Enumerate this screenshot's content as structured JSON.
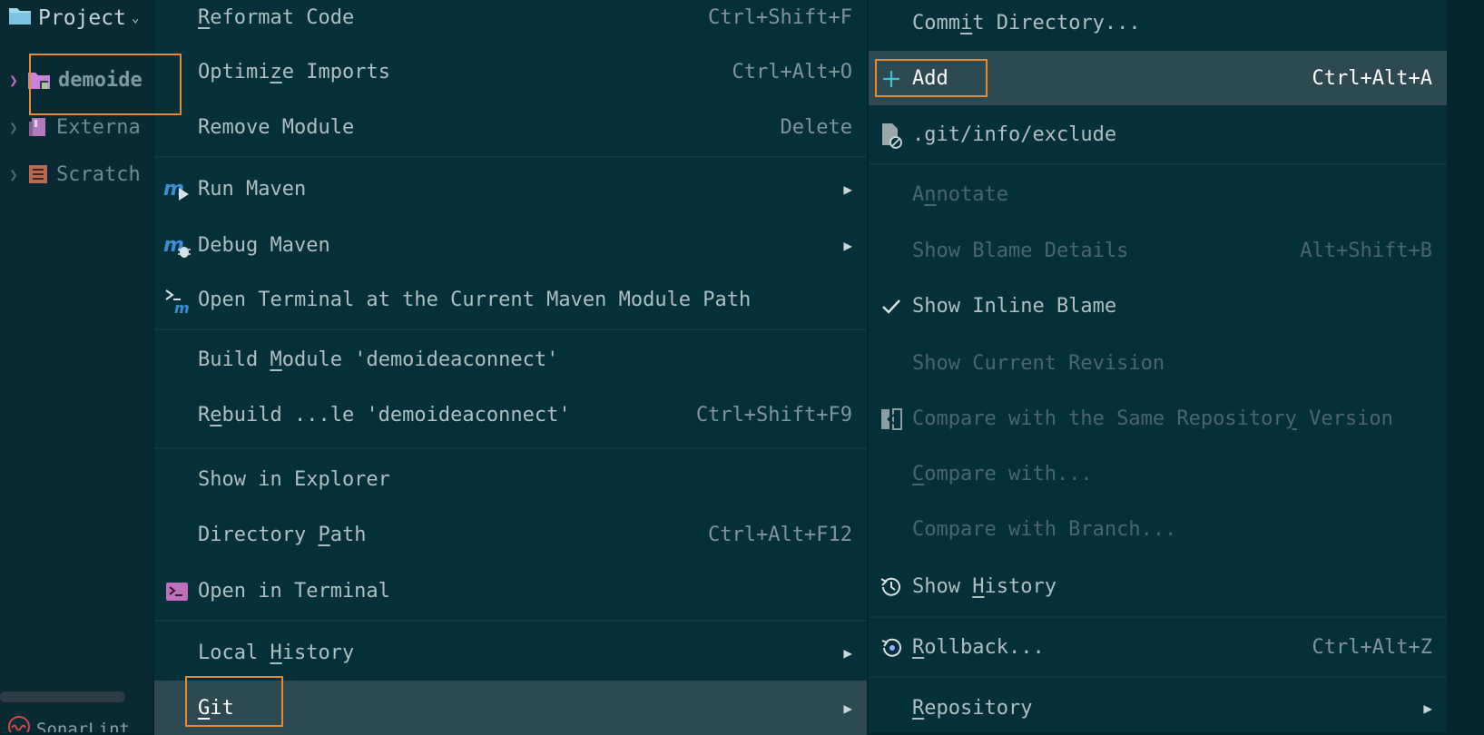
{
  "sidebar": {
    "title": "Project",
    "items": [
      {
        "label": "demoide"
      },
      {
        "label": "Externa"
      },
      {
        "label": "Scratch"
      }
    ],
    "footer": "SonarLint"
  },
  "menu1": {
    "items": [
      {
        "label_pre": "",
        "label_u": "R",
        "label_post": "eformat Code",
        "shortcut": "Ctrl+Shift+F"
      },
      {
        "label_pre": "Optimi",
        "label_u": "z",
        "label_post": "e Imports",
        "shortcut": "Ctrl+Alt+O"
      },
      {
        "label_pre": "Remove Module",
        "label_u": "",
        "label_post": "",
        "shortcut": "Delete"
      },
      {
        "label_pre": "Run Maven",
        "label_u": "",
        "label_post": "",
        "icon": "maven-run-icon"
      },
      {
        "label_pre": "Debug Maven",
        "label_u": "",
        "label_post": "",
        "icon": "maven-debug-icon"
      },
      {
        "label_pre": "Open Terminal at the Current Maven Module Path",
        "label_u": "",
        "label_post": "",
        "icon": "maven-terminal-icon"
      },
      {
        "label_pre": "Build ",
        "label_u": "M",
        "label_post": "odule 'demoideaconnect'"
      },
      {
        "label_pre": "R",
        "label_u": "e",
        "label_post": "build ...le 'demoideaconnect'",
        "shortcut": "Ctrl+Shift+F9"
      },
      {
        "label_pre": "Show in Explorer",
        "label_u": "",
        "label_post": ""
      },
      {
        "label_pre": "Directory ",
        "label_u": "P",
        "label_post": "ath",
        "shortcut": "Ctrl+Alt+F12"
      },
      {
        "label_pre": "Open in Terminal",
        "label_u": "",
        "label_post": "",
        "icon": "terminal-icon"
      },
      {
        "label_pre": "Local ",
        "label_u": "H",
        "label_post": "istory"
      },
      {
        "label_pre": "",
        "label_u": "G",
        "label_post": "it"
      }
    ]
  },
  "menu2": {
    "items": [
      {
        "label_pre": "Comm",
        "label_u": "i",
        "label_post": "t Directory..."
      },
      {
        "label_pre": "Add",
        "label_u": "",
        "label_post": "",
        "shortcut": "Ctrl+Alt+A",
        "icon": "plus-icon"
      },
      {
        "label_pre": ".git/info/exclude",
        "label_u": "",
        "label_post": "",
        "icon": "exclude-file-icon"
      },
      {
        "label_pre": "A",
        "label_u": "n",
        "label_post": "notate"
      },
      {
        "label_pre": "Show Blame Details",
        "label_u": "",
        "label_post": "",
        "shortcut": "Alt+Shift+B"
      },
      {
        "label_pre": "Show Inline Blame",
        "label_u": "",
        "label_post": "",
        "icon": "check-icon"
      },
      {
        "label_pre": "Show Current Revision",
        "label_u": "",
        "label_post": ""
      },
      {
        "label_pre": "Compare with the Same Repositor",
        "label_u": "y",
        "label_post": " Version",
        "icon": "compare-icon"
      },
      {
        "label_pre": "",
        "label_u": "C",
        "label_post": "ompare with..."
      },
      {
        "label_pre": "Compare with Branch...",
        "label_u": "",
        "label_post": ""
      },
      {
        "label_pre": "Show ",
        "label_u": "H",
        "label_post": "istory",
        "icon": "history-icon"
      },
      {
        "label_pre": "",
        "label_u": "R",
        "label_post": "ollback...",
        "shortcut": "Ctrl+Alt+Z",
        "icon": "rollback-icon"
      },
      {
        "label_pre": "",
        "label_u": "R",
        "label_post": "epository"
      }
    ]
  },
  "colors": {
    "background": "#06262f",
    "menu": "#04303a",
    "highlight": "#2d4a52",
    "annotation_box": "#e58a30",
    "maven_blue": "#3a8fd6",
    "plus_cyan": "#3ec3d0"
  }
}
